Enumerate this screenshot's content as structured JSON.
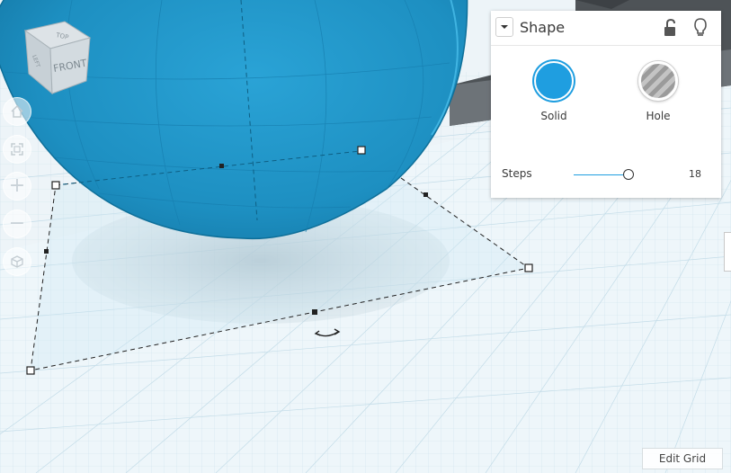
{
  "viewcube": {
    "top_label": "TOP",
    "front_label": "FRONT",
    "left_label": "LEFT"
  },
  "nav_controls": [
    {
      "name": "home-view-button",
      "icon": "home-icon"
    },
    {
      "name": "fit-view-button",
      "icon": "fit-all-icon"
    },
    {
      "name": "zoom-in-button",
      "icon": "plus-icon",
      "glyph": "+"
    },
    {
      "name": "zoom-out-button",
      "icon": "minus-icon",
      "glyph": "−"
    },
    {
      "name": "ortho-view-button",
      "icon": "cube-icon"
    }
  ],
  "shape_panel": {
    "title": "Shape",
    "lock_icon": "unlock-icon",
    "bulb_icon": "lightbulb-icon",
    "options": [
      {
        "label": "Solid",
        "color": "#1f9ee0",
        "selected": true
      },
      {
        "label": "Hole",
        "selected": false
      }
    ],
    "steps": {
      "label": "Steps",
      "value": "18",
      "fraction": 0.92
    }
  },
  "edit_grid_label": "Edit Grid",
  "colors": {
    "shape_blue": "#1f8fbf",
    "selection_accent": "#1f9ee0",
    "grid_line": "#bcd8e6",
    "workplane": "#eaf3f8"
  }
}
